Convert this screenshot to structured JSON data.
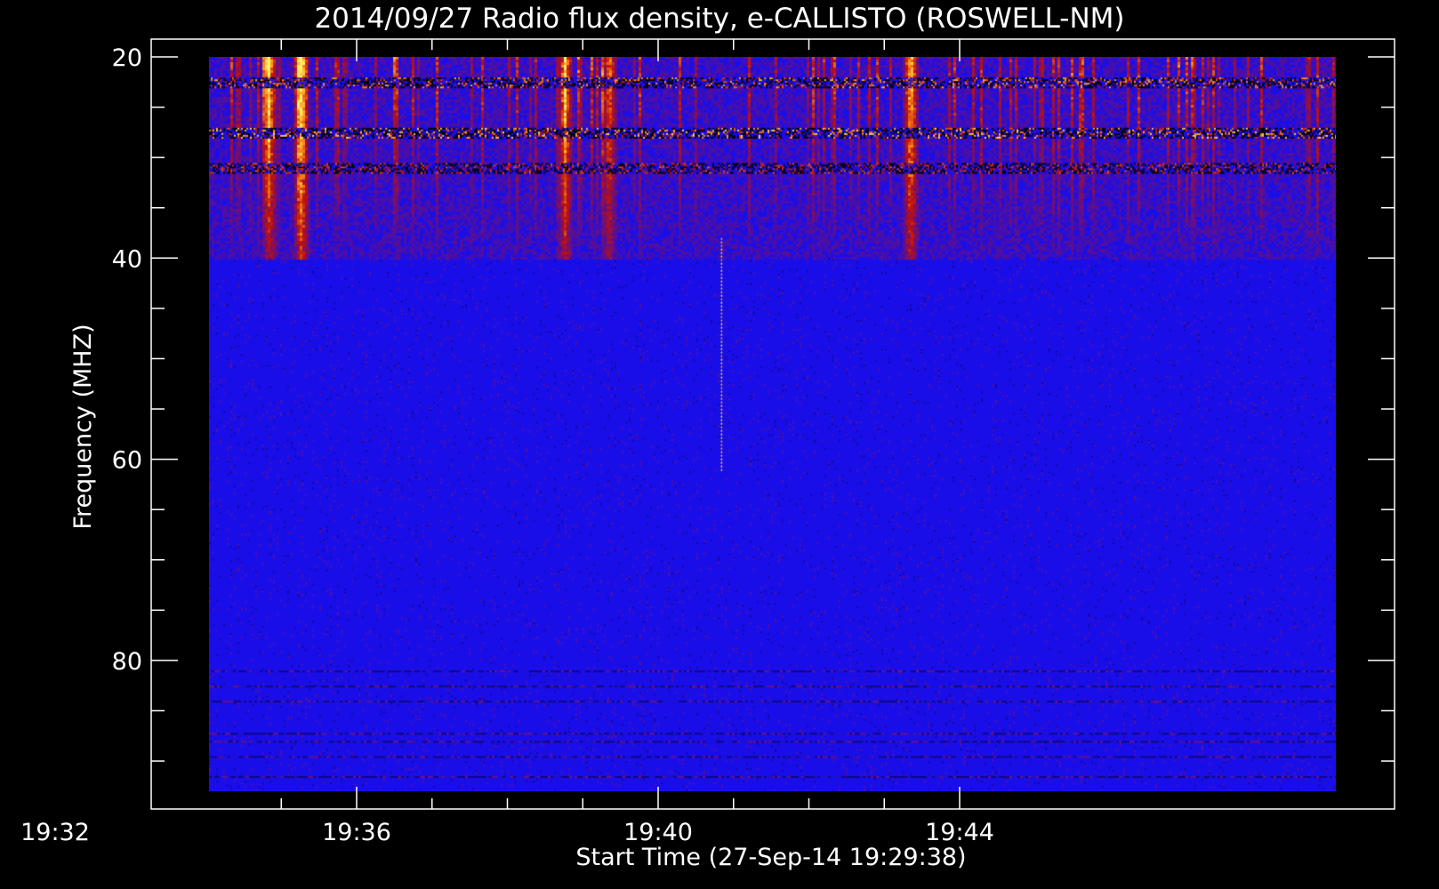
{
  "chart_data": {
    "type": "heatmap",
    "title": "2014/09/27  Radio flux density, e-CALLISTO (ROSWELL-NM)",
    "xlabel": "Start Time (27-Sep-14 19:29:38)",
    "ylabel": "Frequency (MHZ)",
    "x_ticks": [
      "19:32",
      "19:36",
      "19:40",
      "19:44"
    ],
    "y_ticks": [
      "20",
      "40",
      "60",
      "80"
    ],
    "ylim": [
      20,
      93
    ],
    "y_inverted": true,
    "background": "#000000",
    "colormap": [
      "#000000",
      "#1a0ee8",
      "#c0100a",
      "#ff9a1e",
      "#ffef6a"
    ],
    "features": [
      {
        "kind": "interference_band",
        "freq_mhz": 22.5,
        "strength": 0.8
      },
      {
        "kind": "interference_band",
        "freq_mhz": 27.5,
        "strength": 1.0
      },
      {
        "kind": "interference_band",
        "freq_mhz": 31,
        "strength": 0.5
      },
      {
        "kind": "vertical_burst",
        "time": "19:35:15",
        "intensity": 1.0
      },
      {
        "kind": "vertical_burst",
        "time": "19:34:50",
        "intensity": 0.7
      },
      {
        "kind": "vertical_burst",
        "time": "19:38:45",
        "intensity": 0.7
      },
      {
        "kind": "vertical_burst",
        "time": "19:39:20",
        "intensity": 0.6
      },
      {
        "kind": "vertical_burst",
        "time": "19:43:20",
        "intensity": 0.8
      },
      {
        "kind": "narrow_spike",
        "time": "19:40:50",
        "freq_range_mhz": [
          38,
          61
        ]
      }
    ]
  }
}
